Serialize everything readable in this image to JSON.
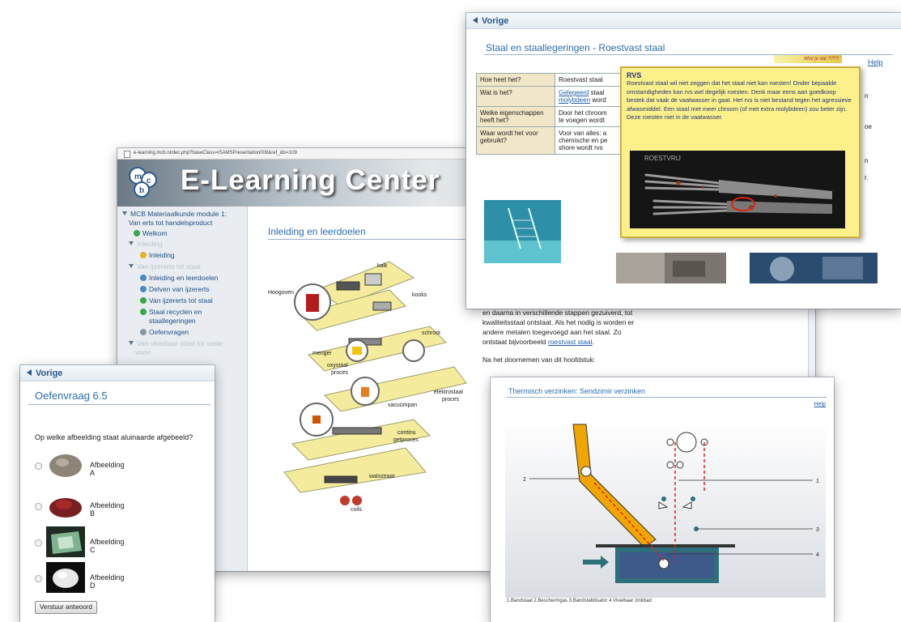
{
  "main": {
    "url": "e-learning.mcb.nl/dec.php?baseClass=ISAMSPresentation008&ref_idx=109",
    "banner_title": "E-Learning Center",
    "sidebar": {
      "module": "MCB Materiaalkunde module 1:",
      "module_sub": "Van erts tot handelsproduct",
      "items": [
        {
          "label": "Welkom",
          "status": "green"
        },
        {
          "label": "Inleiding",
          "status": "dim"
        },
        {
          "label": "Inleiding",
          "status": "yellow"
        },
        {
          "label": "Van ijzererts tot staal",
          "status": "dim"
        },
        {
          "label": "Inleiding en leerdoelen",
          "status": "blue"
        },
        {
          "label": "Delven van ijzererts",
          "status": "blue"
        },
        {
          "label": "Van ijzererts tot staal",
          "status": "green"
        },
        {
          "label": "Staal recyclen en",
          "status": "green"
        },
        {
          "label": "staallegeringen",
          "status": "none"
        },
        {
          "label": "Oefenvragen",
          "status": "gray"
        },
        {
          "label": "Van vloeibaar staal tot vaste",
          "status": "dim"
        },
        {
          "label": "vorm",
          "status": "dim"
        }
      ]
    },
    "content_title": "Inleiding en leerdoelen",
    "process_labels": {
      "hoogoven": "Hoogoven",
      "kalk": "kalk",
      "kooks": "kooks",
      "schroot": "schroot",
      "menger": "menger",
      "oxystaal": "oxystaal",
      "proces": "proces",
      "vacuumpan": "vacuümpan",
      "elektrostaal": "elektrostaal",
      "elektrostaal_proces": "proces",
      "continu": "continu",
      "getproces": "getproces",
      "walsstraat": "walsstraat",
      "coils": "coils"
    }
  },
  "bodytext": {
    "line1": "en daarna in verschillende stappen gezuiverd, tot",
    "line2": "kwaliteitsstaal ontstaat. Als het nodig is worden er",
    "line3": "andere metalen toegevoegd aan het staal. Zo",
    "line4_pre": "ontstaat bijvoorbeeld ",
    "line4_link": "roestvast staal",
    "line4_post": ".",
    "line5": "Na het doornemen van dit hoofdstuk:"
  },
  "quiz": {
    "vorige": "Vorige",
    "title": "Oefenvraag 6.5",
    "question": "Op welke afbeelding staat aluinaarde afgebeeld?",
    "options": [
      "Afbeelding A",
      "Afbeelding B",
      "Afbeelding C",
      "Afbeelding D"
    ],
    "submit": "Verstuur antwoord"
  },
  "staal": {
    "vorige": "Vorige",
    "title": "Staal en staallegeringen - Roestvast staal",
    "weet_je": "Wist je dat ????",
    "help": "Help",
    "rows": [
      {
        "q": "Hoe heet het?",
        "a1": "Roestvast staal",
        "a2": "",
        "x": ""
      },
      {
        "q": "Wat is het?",
        "a1_link": "Gelegeerd",
        "a1": " staal",
        "a2_link": "molybdeen",
        "a2": " word",
        "x": "n"
      },
      {
        "q": "Welke eigenschappen heeft het?",
        "a1": "Door het chroom",
        "a2": "te voegen wordt",
        "x": "oe"
      },
      {
        "q": "Waar wordt het voor gebruikt?",
        "a1": "Voor van alles: a",
        "a2": "chemische en pe",
        "a3": "shore wordt rvs",
        "x": "n",
        "x2": "r."
      }
    ],
    "rvs": {
      "title": "RVS",
      "body": "Roestvast staal wil niet zeggen dat het staal niet kan roesten! Onder bepaalde omstandigheden kan rvs wel degelijk roesten. Denk maar eens aan goedkoop bestek dat vaak de vaatwasser in gaat. Het rvs is niet bestand tegen het agressieve afwasmiddel. Een staal met meer chroom (of met extra molybdeen) zou beter zijn. Deze roesten niet in de vaatwasser.",
      "photo_text": "ROESTVRIJ"
    }
  },
  "sendzimir": {
    "title": "Thermisch verzinken: Sendzimir verzinken",
    "help": "Help",
    "labels": {
      "l1": "1",
      "l2": "2",
      "l3": "3",
      "l4": "4"
    },
    "caption": "1.Bandstaal 2.Beschermgas 3.Bandstabilisator 4.Vloeibaar zinkbad"
  }
}
